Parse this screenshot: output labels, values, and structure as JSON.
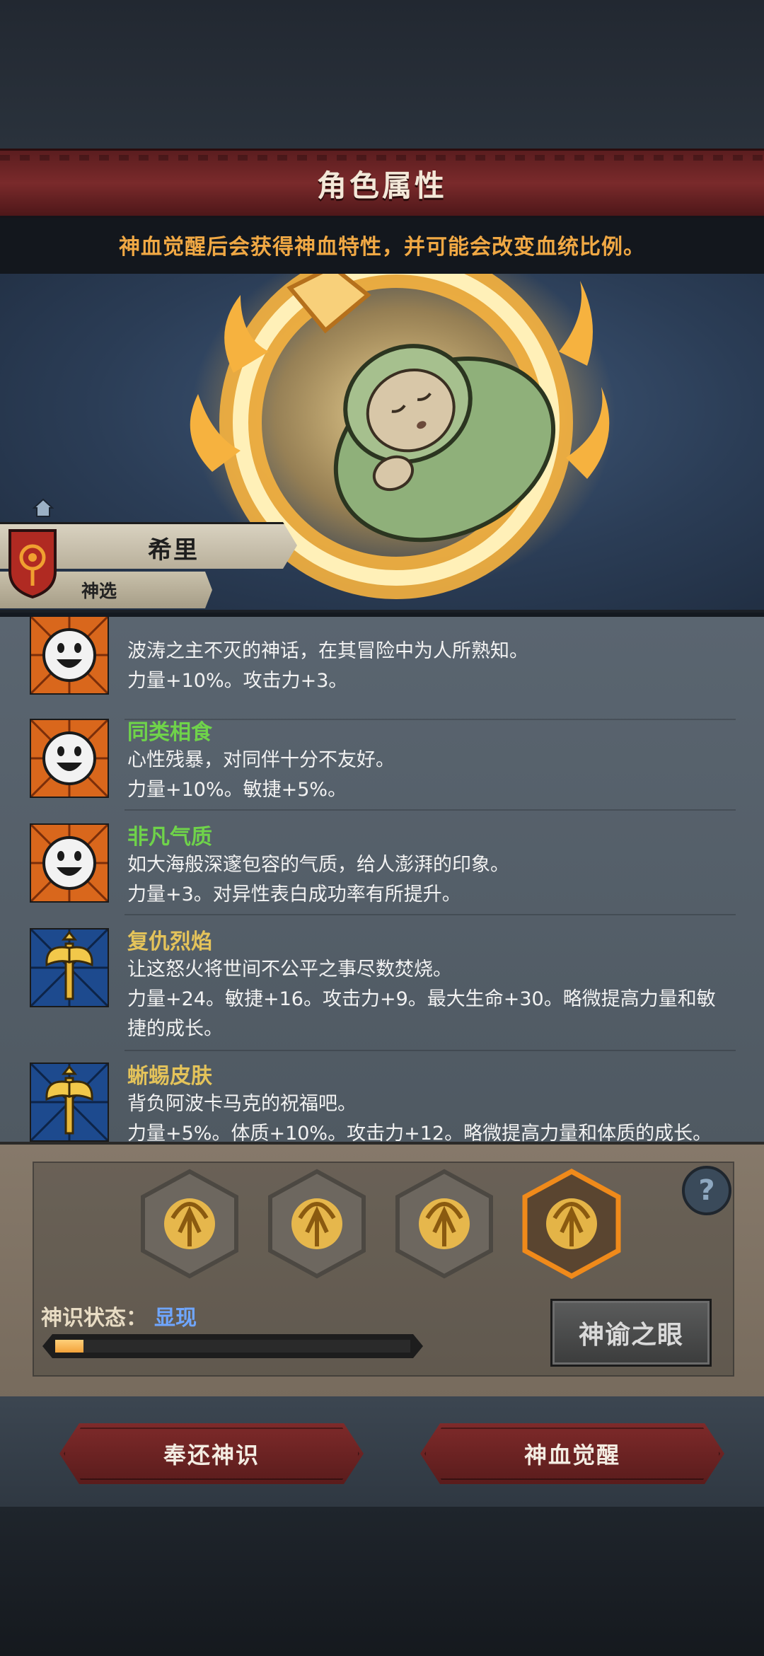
{
  "header": {
    "title": "角色属性"
  },
  "notice": {
    "text": "神血觉醒后会获得神血特性，并可能会改变血统比例。"
  },
  "character": {
    "name": "希里",
    "subtitle": "神选"
  },
  "traits": [
    {
      "name": "",
      "name_color": "green",
      "icon": "smiley-face-icon",
      "desc": "波涛之主不灭的神话，在其冒险中为人所熟知。",
      "effect": "力量+10%。攻击力+3。"
    },
    {
      "name": "同类相食",
      "name_color": "green",
      "icon": "smiley-face-icon",
      "desc": "心性残暴，对同伴十分不友好。",
      "effect": "力量+10%。敏捷+5%。"
    },
    {
      "name": "非凡气质",
      "name_color": "green",
      "icon": "smiley-face-icon",
      "desc": "如大海般深邃包容的气质，给人澎湃的印象。",
      "effect": "力量+3。对异性表白成功率有所提升。"
    },
    {
      "name": "复仇烈焰",
      "name_color": "gold",
      "icon": "golden-axe-icon",
      "desc": "让这怒火将世间不公平之事尽数焚烧。",
      "effect": "力量+24。敏捷+16。攻击力+9。最大生命+30。略微提高力量和敏捷的成长。"
    },
    {
      "name": "蜥蜴皮肤",
      "name_color": "gold",
      "icon": "golden-axe-icon",
      "desc": "背负阿波卡马克的祝福吧。",
      "effect": "力量+5%。体质+10%。攻击力+12。略微提高力量和体质的成长。"
    }
  ],
  "divine_panel": {
    "slots": [
      "flame-trident-icon",
      "flame-trident-icon",
      "flame-trident-icon",
      "flame-trident-icon"
    ],
    "selected_slot": 4,
    "help_label": "?",
    "state_label": "神识状态：",
    "state_value": "显现",
    "progress": 0.08,
    "oracle_button": "神谕之眼"
  },
  "actions": {
    "return_button": "奉还神识",
    "awaken_button": "神血觉醒"
  }
}
